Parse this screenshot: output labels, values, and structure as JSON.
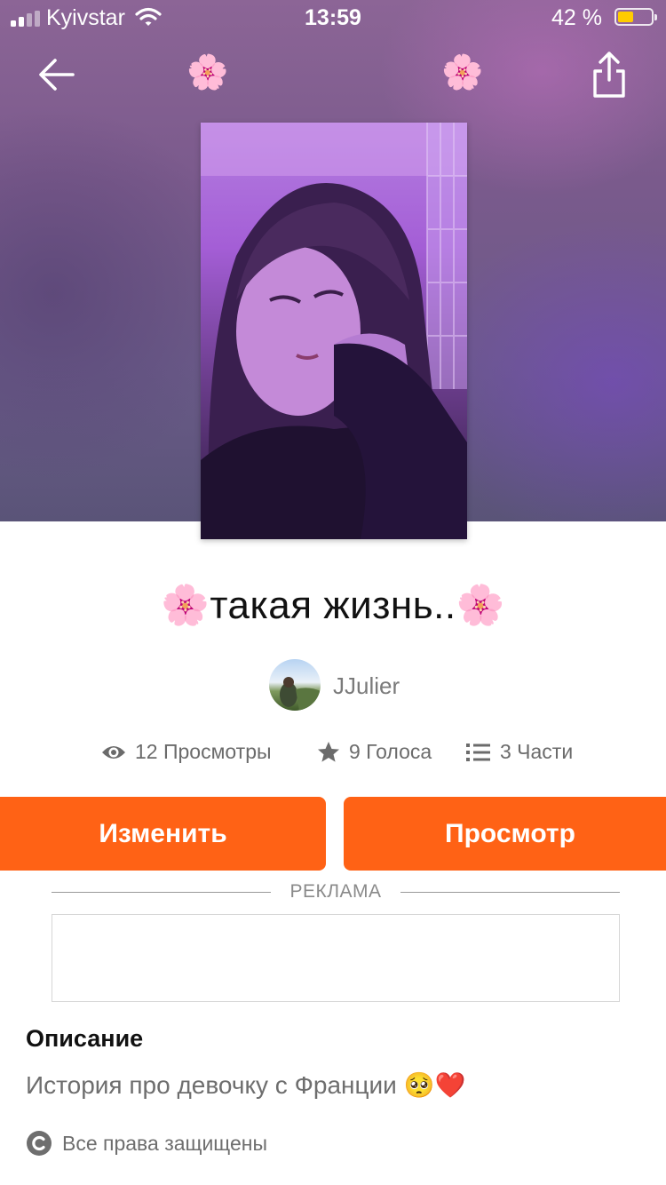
{
  "status_bar": {
    "carrier": "Kyivstar",
    "time": "13:59",
    "battery_percent": "42 %",
    "battery_level": 0.42,
    "battery_color": "#ffcc00"
  },
  "header": {
    "back_icon": "arrow-left-icon",
    "flower_left": "🌸",
    "flower_right": "🌸",
    "share_icon": "share-icon"
  },
  "story": {
    "title": "🌸такая жизнь..🌸",
    "author": "JJulier",
    "stats": {
      "views": "12 Просмотры",
      "votes": "9 Голоса",
      "parts": "3 Части"
    }
  },
  "actions": {
    "edit_label": "Изменить",
    "preview_label": "Просмотр",
    "accent_color": "#ff6215"
  },
  "ad": {
    "label": "РЕКЛАМА"
  },
  "description": {
    "heading": "Описание",
    "text": "История про девочку с Франции 🥺❤️"
  },
  "copyright": {
    "text": "Все права защищены"
  }
}
